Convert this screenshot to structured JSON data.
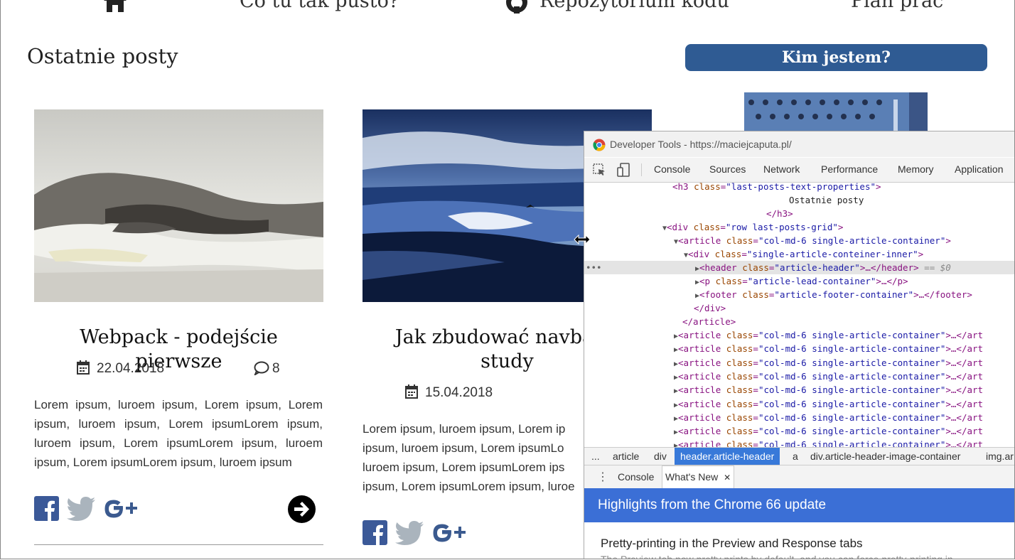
{
  "nav": {
    "items": [
      "Co tu tak pusto?",
      "Repozytorium kodu",
      "Plan prac"
    ]
  },
  "section_title": "Ostatnie posty",
  "about_button": "Kim jestem?",
  "articles": [
    {
      "title": "Webpack - podejście pierwsze",
      "date": "22.04.2018",
      "comments": "8",
      "lead": "Lorem ipsum, luroem ipsum, Lorem ipsum, Lorem ipsum, luroem ipsum, Lorem ipsumLorem ipsum, luroem ipsum, Lorem ipsumLorem ipsum, luroem ipsum, Lorem ipsumLorem ipsum, luroem ipsum"
    },
    {
      "title_line1": "Jak zbudować navbar ?",
      "title_line2": "study",
      "date": "15.04.2018",
      "lead_lines": [
        "Lorem ipsum, luroem ipsum, Lorem ip",
        "ipsum, luroem ipsum, Lorem ipsumLo",
        "luroem ipsum, Lorem ipsumLorem ips",
        "ipsum, Lorem ipsumLorem ipsum, luroe"
      ]
    }
  ],
  "devtools": {
    "window_title": "Developer Tools - https://maciejcaputa.pl/",
    "tabs": [
      "Console",
      "Sources",
      "Network",
      "Performance",
      "Memory",
      "Application"
    ],
    "dom": {
      "h3_open_tag": "<h3",
      "h3_class_attr": "class",
      "h3_class_val": "\"last-posts-text-properties\"",
      "h3_text": "Ostatnie posty",
      "h3_close": "</h3>",
      "div_row": "<div",
      "div_row_val": "\"row last-posts-grid\"",
      "article_open": "<article",
      "article_val": "\"col-md-6 single-article-container\"",
      "inner_div": "<div",
      "inner_div_val": "\"single-article-conteiner-inner\"",
      "header_open": "<header",
      "header_val": "\"article-header\"",
      "header_close": "…</header>",
      "header_marker": "== $0",
      "p_open": "<p",
      "p_val": "\"article-lead-container\"",
      "p_close": "…</p>",
      "footer_open": "<footer",
      "footer_val": "\"article-footer-container\"",
      "footer_close": "…</footer>",
      "div_close": "</div>",
      "article_close": "</article>",
      "collapsed_article": "…</art",
      "class_word": "class"
    },
    "breadcrumbs": [
      "...",
      "article",
      "div",
      "header.article-header",
      "a",
      "div.article-header-image-container",
      "img.ar"
    ],
    "drawer_tabs": [
      "Console",
      "What's New"
    ],
    "drawer_close": "✕",
    "highlight": "Highlights from the Chrome 66 update",
    "news_title": "Pretty-printing in the Preview and Response tabs",
    "news_sub": "The Preview tab now pretty prints by default, and you can force pretty-printing in"
  }
}
